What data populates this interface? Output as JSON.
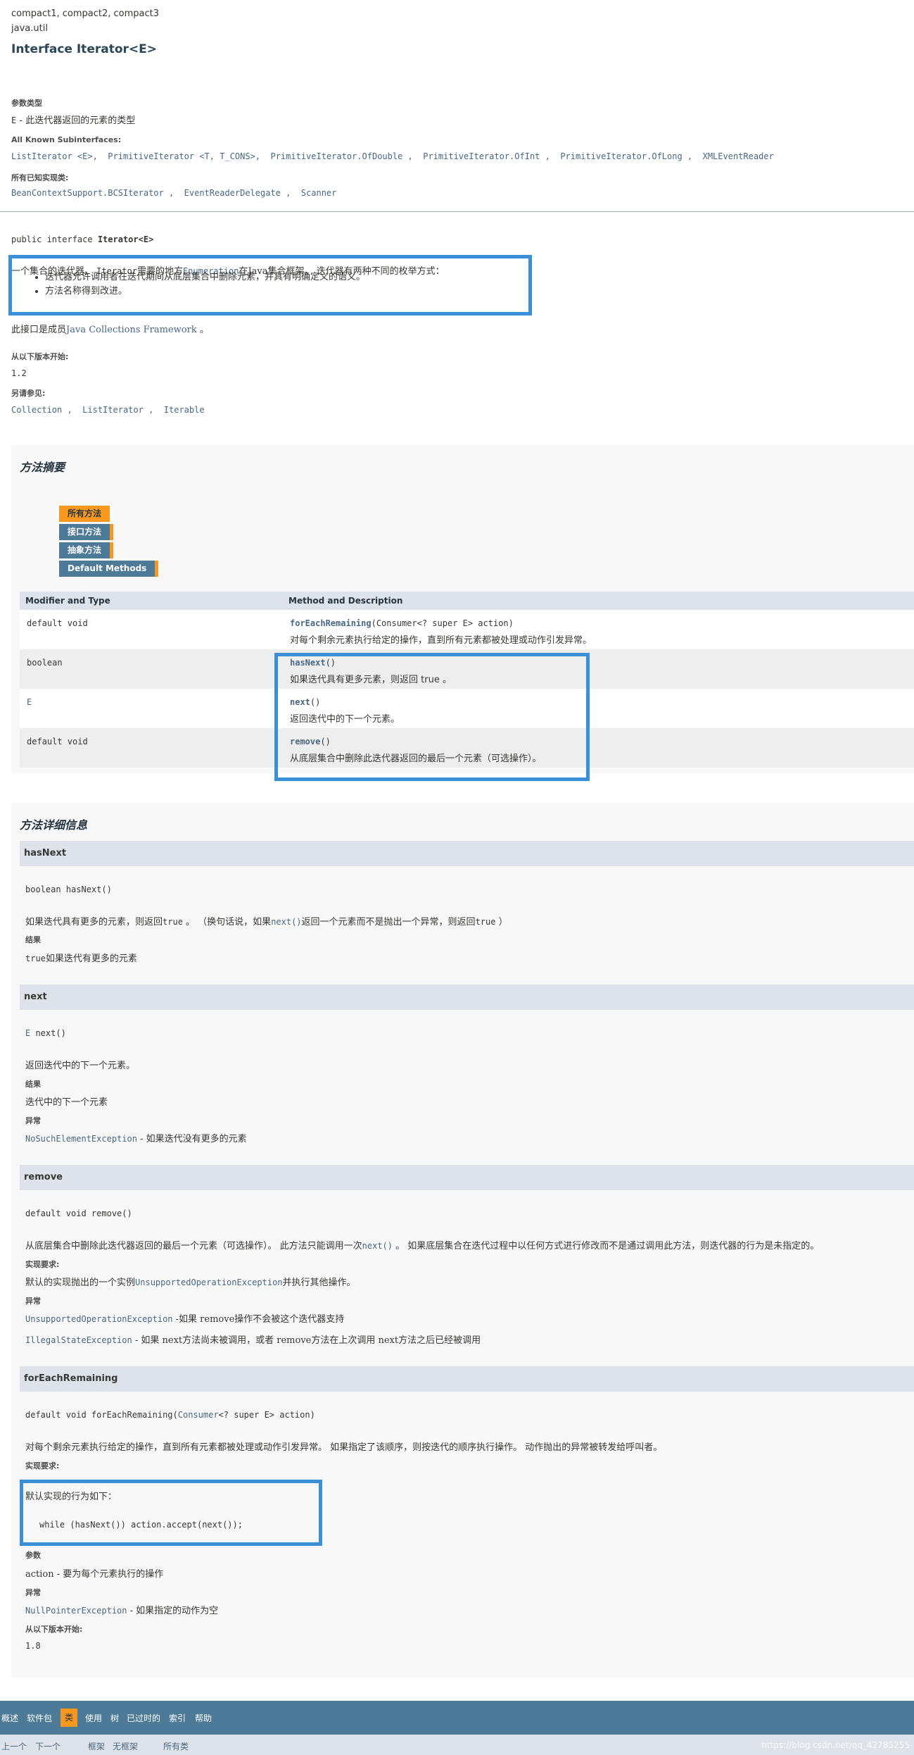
{
  "header": {
    "profiles": "compact1, compact2, compact3",
    "package": "java.util",
    "title": "Interface Iterator<E>"
  },
  "type_params": {
    "label": "参数类型",
    "e_name": "E",
    "e_desc": " - 此迭代器返回的元素的类型"
  },
  "subinterfaces": {
    "label": "All Known Subinterfaces:",
    "items": [
      "ListIterator <E>,",
      "PrimitiveIterator <T, T_CONS>,",
      "PrimitiveIterator.OfDouble ,",
      "PrimitiveIterator.OfInt ,",
      "PrimitiveIterator.OfLong ,",
      "XMLEventReader"
    ]
  },
  "impl_classes": {
    "label": "所有已知实现类:",
    "items": [
      "BeanContextSupport.BCSIterator ,",
      "EventReaderDelegate ,",
      "Scanner"
    ]
  },
  "declaration": {
    "prefix": "public interface ",
    "name": "Iterator<E>"
  },
  "description": {
    "line1_a": "一个集合的迭代器。 ",
    "line1_code": "Iterator",
    "line1_b": "需要的地方",
    "line1_link": "Enumeration",
    "line1_c": "在Java集合框架。 迭代器有两种不同的枚举方式：",
    "bullets": [
      "迭代器允许调用者在迭代期间从底层集合中删除元素，并具有明确定义的语义。",
      "方法名称得到改进。"
    ],
    "member_a": "此接口是成员",
    "member_link": "Java Collections Framework",
    "member_b": " 。"
  },
  "since": {
    "label": "从以下版本开始:",
    "value": "1.2"
  },
  "see_also": {
    "label": "另请参见:",
    "items": [
      "Collection ,",
      "ListIterator ,",
      "Iterable"
    ]
  },
  "summary": {
    "title": "方法摘要",
    "tabs": [
      "所有方法",
      "接口方法",
      "抽象方法",
      "Default Methods"
    ],
    "col_type": "Modifier and Type",
    "col_method": "Method and Description",
    "rows": [
      {
        "type": "default void",
        "method": "forEachRemaining",
        "params": "(Consumer<? super E> action)",
        "desc": "对每个剩余元素执行给定的操作，直到所有元素都被处理或动作引发异常。"
      },
      {
        "type": "boolean",
        "method": "hasNext",
        "params": "()",
        "desc": "如果迭代具有更多元素，则返回 true 。"
      },
      {
        "type": "E",
        "method": "next",
        "params": "()",
        "desc": "返回迭代中的下一个元素。"
      },
      {
        "type": "default void",
        "method": "remove",
        "params": "()",
        "desc": "从底层集合中删除此迭代器返回的最后一个元素（可选操作）。"
      }
    ]
  },
  "details": {
    "title": "方法详细信息",
    "hasNext": {
      "name": "hasNext",
      "sig": "boolean hasNext()",
      "desc_a": "如果迭代具有更多的元素，则返回",
      "desc_code": "true",
      "desc_b": " 。 （换句话说，如果",
      "desc_link": "next()",
      "desc_c": "返回一个元素而不是抛出一个异常，则返回",
      "desc_code2": "true",
      "desc_d": " ）",
      "result_label": "结果",
      "result_code": "true",
      "result_text": "如果迭代有更多的元素"
    },
    "next": {
      "name": "next",
      "sig_type": "E",
      "sig_rest": " next()",
      "desc": "返回迭代中的下一个元素。",
      "result_label": "结果",
      "result_text": "迭代中的下一个元素",
      "throws_label": "异常",
      "throws_link": "NoSuchElementException",
      "throws_text": " - 如果迭代没有更多的元素"
    },
    "remove": {
      "name": "remove",
      "sig": "default void remove()",
      "desc_a": "从底层集合中删除此迭代器返回的最后一个元素（可选操作）。 此方法只能调用一次",
      "desc_link": "next()",
      "desc_b": " 。 如果底层集合在迭代过程中以任何方式进行修改而不是通过调用此方法，则迭代器的行为是未指定的。",
      "impl_label": "实现要求:",
      "impl_a": "默认的实现抛出的一个实例",
      "impl_link": "UnsupportedOperationException",
      "impl_b": "并执行其他操作。",
      "throws_label": "异常",
      "throws1_link": "UnsupportedOperationException",
      "throws1_text": " -如果 remove操作不会被这个迭代器支持",
      "throws2_link": "IllegalStateException",
      "throws2_text": " - 如果 next方法尚未被调用，或者 remove方法在上次调用 next方法之后已经被调用"
    },
    "forEachRemaining": {
      "name": "forEachRemaining",
      "sig_a": "default void forEachRemaining(",
      "sig_link": "Consumer",
      "sig_b": "<? super E> action)",
      "desc": "对每个剩余元素执行给定的操作，直到所有元素都被处理或动作引发异常。 如果指定了该顺序，则按迭代的顺序执行操作。 动作抛出的异常被转发给呼叫者。",
      "impl_label": "实现要求:",
      "impl_text": "默认实现的行为如下：",
      "impl_code": "while (hasNext()) action.accept(next());",
      "params_label": "参数",
      "param_text": "action - 要为每个元素执行的操作",
      "throws_label": "异常",
      "throws_link": "NullPointerException",
      "throws_text": " - 如果指定的动作为空",
      "since_label": "从以下版本开始:",
      "since_value": "1.8"
    }
  },
  "bottom_nav": {
    "items": [
      "概述",
      "软件包",
      "类",
      "使用",
      "树",
      "已过时的",
      "索引",
      "帮助"
    ],
    "active": "类",
    "sub": [
      "上一个",
      "下一个",
      "框架",
      "无框架",
      "所有类"
    ],
    "watermark": "https://blog.csdn.net/qq_42785255"
  },
  "colors": {
    "accent_box": "#3b8fd6",
    "nav_bg": "#4d7a97",
    "tab_active": "#f8981d"
  }
}
